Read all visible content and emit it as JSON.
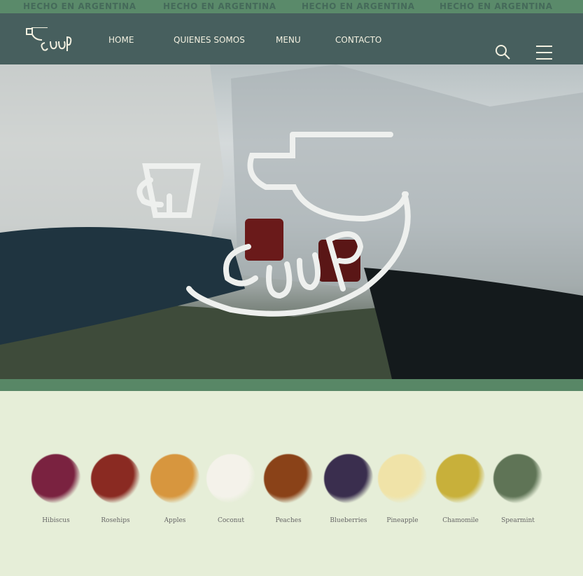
{
  "ticker": {
    "text": "HECHO EN ARGENTINA"
  },
  "nav": {
    "logo": "CUUP",
    "items": [
      "HOME",
      "QUIENES SOMOS",
      "MENU",
      "CONTACTO"
    ]
  },
  "hero": {
    "logo_text": "CUUP"
  },
  "ingredients": [
    {
      "label": "Hibiscus",
      "color": "#7a2240"
    },
    {
      "label": "Rosehips",
      "color": "#8a2a22"
    },
    {
      "label": "Apples",
      "color": "#d7963e"
    },
    {
      "label": "Coconut",
      "color": "#f4f2ea"
    },
    {
      "label": "Peaches",
      "color": "#8a4218"
    },
    {
      "label": "Blueberries",
      "color": "#3a2e4e"
    },
    {
      "label": "Pineapple",
      "color": "#f0e3a8"
    },
    {
      "label": "Chamomile",
      "color": "#c8b03a"
    },
    {
      "label": "Spearmint",
      "color": "#5f7456"
    }
  ]
}
